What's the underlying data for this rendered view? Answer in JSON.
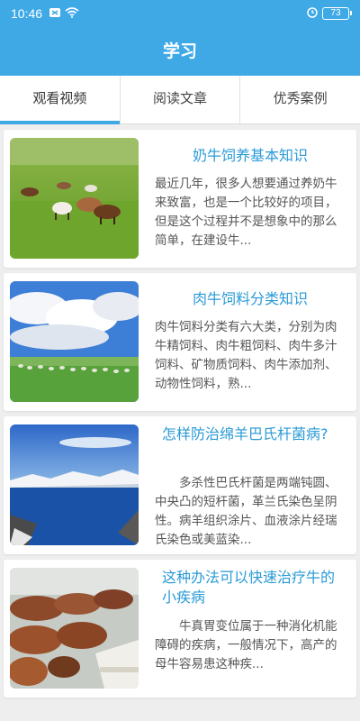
{
  "status_bar": {
    "time": "10:46",
    "battery": "73"
  },
  "header": {
    "title": "学习"
  },
  "tabs": [
    {
      "label": "观看视频",
      "active": true
    },
    {
      "label": "阅读文章",
      "active": false
    },
    {
      "label": "优秀案例",
      "active": false
    }
  ],
  "articles": [
    {
      "title": "奶牛饲养基本知识",
      "summary": "最近几年，很多人想要通过养奶牛来致富，也是一个比较好的项目，但是这个过程并不是想象中的那么简单，在建设牛..."
    },
    {
      "title": "肉牛饲料分类知识",
      "summary": "肉牛饲料分类有六大类，分别为肉牛精饲料、肉牛粗饲料、肉牛多汁饲料、矿物质饲料、肉牛添加剂、动物性饲料，熟..."
    },
    {
      "title": "怎样防治绵羊巴氏杆菌病?",
      "summary": "多杀性巴氏杆菌是两端钝圆、中央凸的短杆菌，革兰氏染色呈阴性。病羊组织涂片、血液涂片经瑞氏染色或美蓝染..."
    },
    {
      "title": "这种办法可以快速治疗牛的小疾病",
      "summary": "牛真胃变位属于一种消化机能障碍的疾病，一般情况下，高产的母牛容易患这种疾..."
    }
  ],
  "colors": {
    "accent": "#3fa9e6",
    "title_text": "#2a9ad6"
  }
}
